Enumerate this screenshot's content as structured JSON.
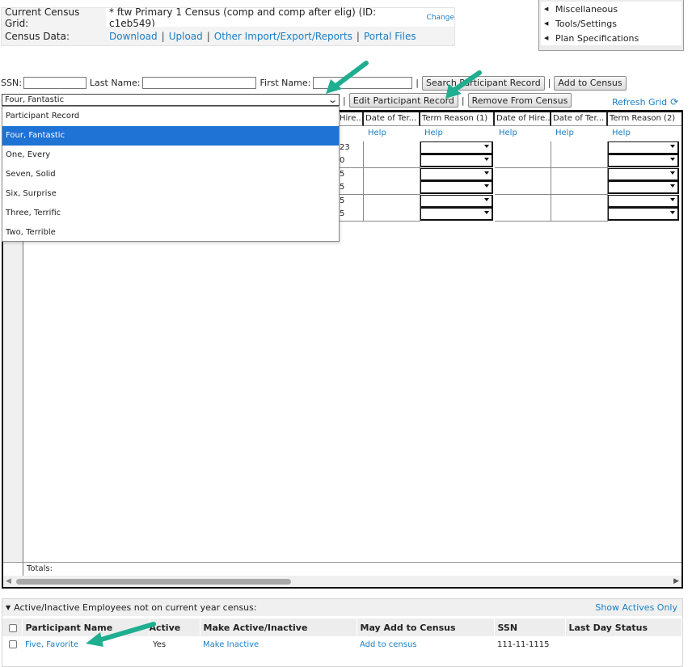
{
  "census_info": {
    "grid_label": "Current Census Grid:",
    "grid_value": "* ftw Primary 1 Census (comp and comp after elig) (ID: c1eb549)",
    "change_link": "Change",
    "data_label": "Census Data:",
    "links": [
      "Download",
      "Upload",
      "Other Import/Export/Reports",
      "Portal Files"
    ]
  },
  "side_menu": {
    "items": [
      "Miscellaneous",
      "Tools/Settings",
      "Plan Specifications"
    ]
  },
  "search": {
    "ssn_label": "SSN:",
    "last_name_label": "Last Name:",
    "first_name_label": "First Name:",
    "search_button": "Search Participant Record",
    "add_button": "Add to Census"
  },
  "participant_select": {
    "selected": "Four, Fantastic",
    "edit_button": "Edit Participant Record",
    "remove_button": "Remove From Census",
    "refresh_label": "Refresh Grid",
    "options": [
      "Participant Record",
      "Four, Fantastic",
      "One, Every",
      "Seven, Solid",
      "Six, Surprise",
      "Three, Terrific",
      "Two, Terrible"
    ]
  },
  "grid": {
    "headers": [
      "Hire...",
      "Date of Ter...",
      "Term Reason (1)",
      "Date of Hire...",
      "Date of Ter...",
      "Term Reason (2)"
    ],
    "help_label": "Help",
    "partial_values": [
      "23",
      "0",
      "5",
      "5",
      "5",
      "5"
    ],
    "totals_label": "Totals:"
  },
  "inactive_panel": {
    "title": "Active/Inactive Employees not on current year census:",
    "show_actives": "Show Actives Only",
    "columns": [
      "Participant Name",
      "Active",
      "Make Active/Inactive",
      "May Add to Census",
      "SSN",
      "Last Day Status"
    ],
    "rows": [
      {
        "name": "Five, Favorite",
        "active": "Yes",
        "make": "Make Inactive",
        "add": "Add to census",
        "ssn": "111-11-1115",
        "status": ""
      }
    ]
  },
  "colors": {
    "link": "#1a7fc4",
    "selected": "#1e73d4",
    "arrow": "#1fae8f"
  }
}
